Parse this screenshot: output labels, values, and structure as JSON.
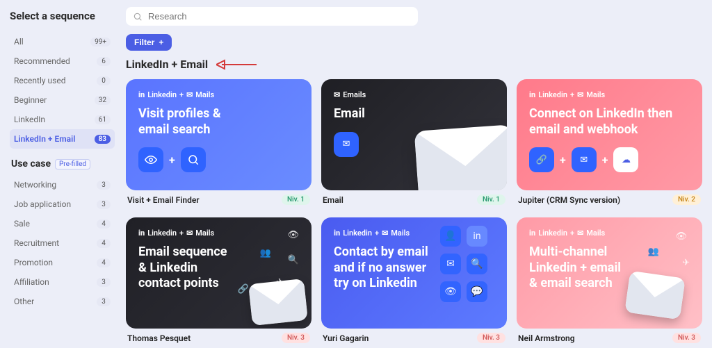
{
  "sidebar": {
    "title": "Select a sequence",
    "filters": [
      {
        "label": "All",
        "count": "99+"
      },
      {
        "label": "Recommended",
        "count": "6"
      },
      {
        "label": "Recently used",
        "count": "0"
      },
      {
        "label": "Beginner",
        "count": "32"
      },
      {
        "label": "LinkedIn",
        "count": "61"
      },
      {
        "label": "LinkedIn + Email",
        "count": "83"
      }
    ],
    "usecase_title": "Use case",
    "prefilled_label": "Pre-filled",
    "usecases": [
      {
        "label": "Networking",
        "count": "3"
      },
      {
        "label": "Job application",
        "count": "3"
      },
      {
        "label": "Sale",
        "count": "4"
      },
      {
        "label": "Recruitment",
        "count": "4"
      },
      {
        "label": "Promotion",
        "count": "4"
      },
      {
        "label": "Affiliation",
        "count": "3"
      },
      {
        "label": "Other",
        "count": "3"
      }
    ]
  },
  "search": {
    "placeholder": "Research"
  },
  "filter_button": "Filter",
  "section_heading": "LinkedIn + Email",
  "tags": {
    "in": "in",
    "linkedin": "Linkedin",
    "plus": "+",
    "mails": "Mails",
    "emails": "Emails"
  },
  "cards": [
    {
      "title": "Visit profiles & email search",
      "name": "Visit + Email Finder",
      "niv": "Niv. 1",
      "niv_class": "l1",
      "bg": "bg-blue",
      "tags": "li_mails"
    },
    {
      "title": "Email",
      "name": "Email",
      "niv": "Niv. 1",
      "niv_class": "l1",
      "bg": "bg-dark",
      "tags": "emails"
    },
    {
      "title": "Connect on LinkedIn then email and webhook",
      "name": "Jupiter (CRM Sync version)",
      "niv": "Niv. 2",
      "niv_class": "l2",
      "bg": "bg-pink",
      "tags": "li_mails"
    },
    {
      "title": "Email sequence & Linkedin contact points",
      "name": "Thomas Pesquet",
      "niv": "Niv. 3",
      "niv_class": "l3",
      "bg": "bg-dark2",
      "tags": "li_mails"
    },
    {
      "title": "Contact by email and if no answer try on Linkedin",
      "name": "Yuri Gagarin",
      "niv": "Niv. 3",
      "niv_class": "l3",
      "bg": "bg-blue2",
      "tags": "li_mails"
    },
    {
      "title": "Multi-channel Linkedin + email & email search",
      "name": "Neil Armstrong",
      "niv": "Niv. 3",
      "niv_class": "l3",
      "bg": "bg-pink2",
      "tags": "li_mails"
    }
  ]
}
